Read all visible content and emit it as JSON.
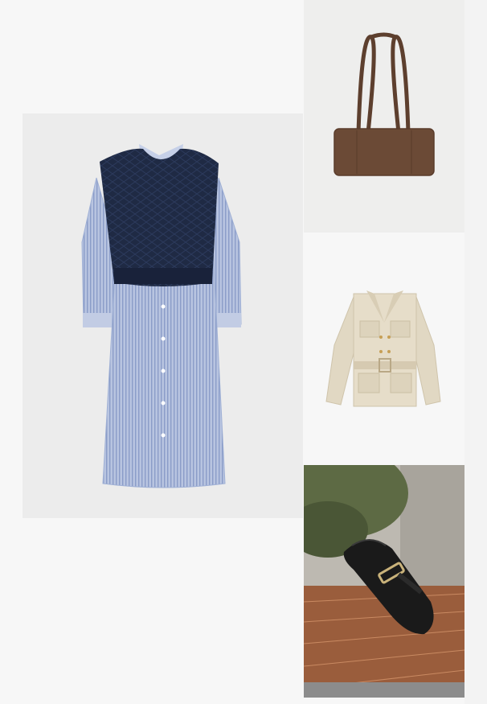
{
  "board": {
    "background_color": "#f7f7f7",
    "items": [
      {
        "name": "dress",
        "icon": "striped-shirt-dress-with-cable-knit-vest"
      },
      {
        "name": "bag",
        "icon": "brown-suede-shoulder-bag"
      },
      {
        "name": "jacket",
        "icon": "beige-belted-safari-jacket"
      },
      {
        "name": "shoe",
        "icon": "black-leather-buckle-loafer"
      }
    ]
  },
  "colors": {
    "dress_stripe": "#9eaed3",
    "vest_navy": "#1f2a44",
    "bag_brown": "#6b4a36",
    "jacket_beige": "#e3dac6",
    "shoe_black": "#1a1a1a",
    "brick": "#b0714a"
  }
}
